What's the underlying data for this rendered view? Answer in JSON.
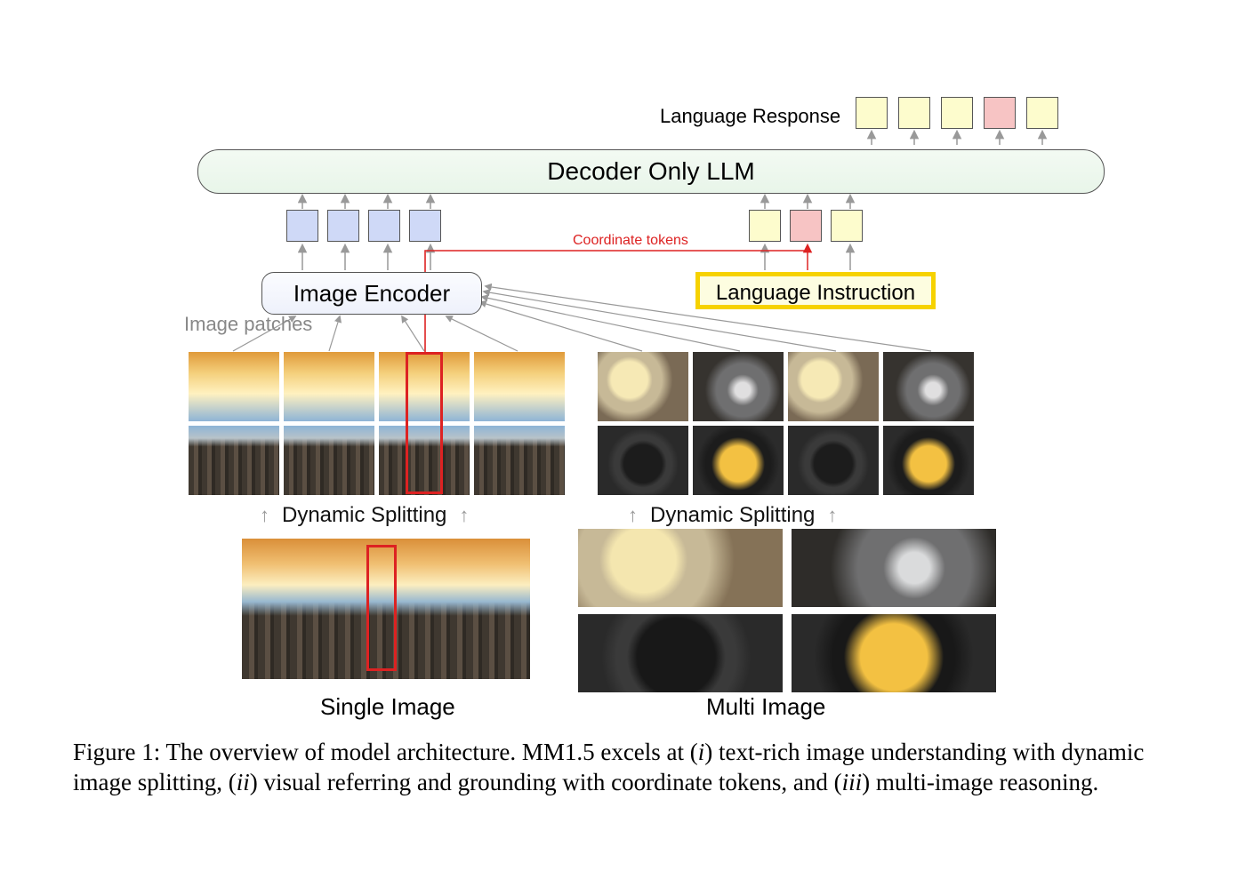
{
  "labels": {
    "language_response": "Language Response",
    "decoder": "Decoder Only LLM",
    "image_encoder": "Image Encoder",
    "language_instruction": "Language Instruction",
    "coordinate_tokens": "Coordinate tokens",
    "image_patches": "Image patches",
    "dynamic_splitting": "Dynamic Splitting",
    "single_image": "Single Image",
    "multi_image": "Multi Image"
  },
  "output_tokens": [
    "lang",
    "lang",
    "lang",
    "coord",
    "lang"
  ],
  "visual_tokens": 4,
  "lang_in_tokens": [
    "lang",
    "coord",
    "lang"
  ],
  "caption": {
    "prefix": "Figure 1: The overview of model architecture. MM1.5 excels at (",
    "i": "i",
    "part1": ") text-rich image understanding with dynamic image splitting, (",
    "ii": "ii",
    "part2": ") visual referring and grounding with coordinate tokens, and (",
    "iii": "iii",
    "part3": ") multi-image reasoning."
  }
}
